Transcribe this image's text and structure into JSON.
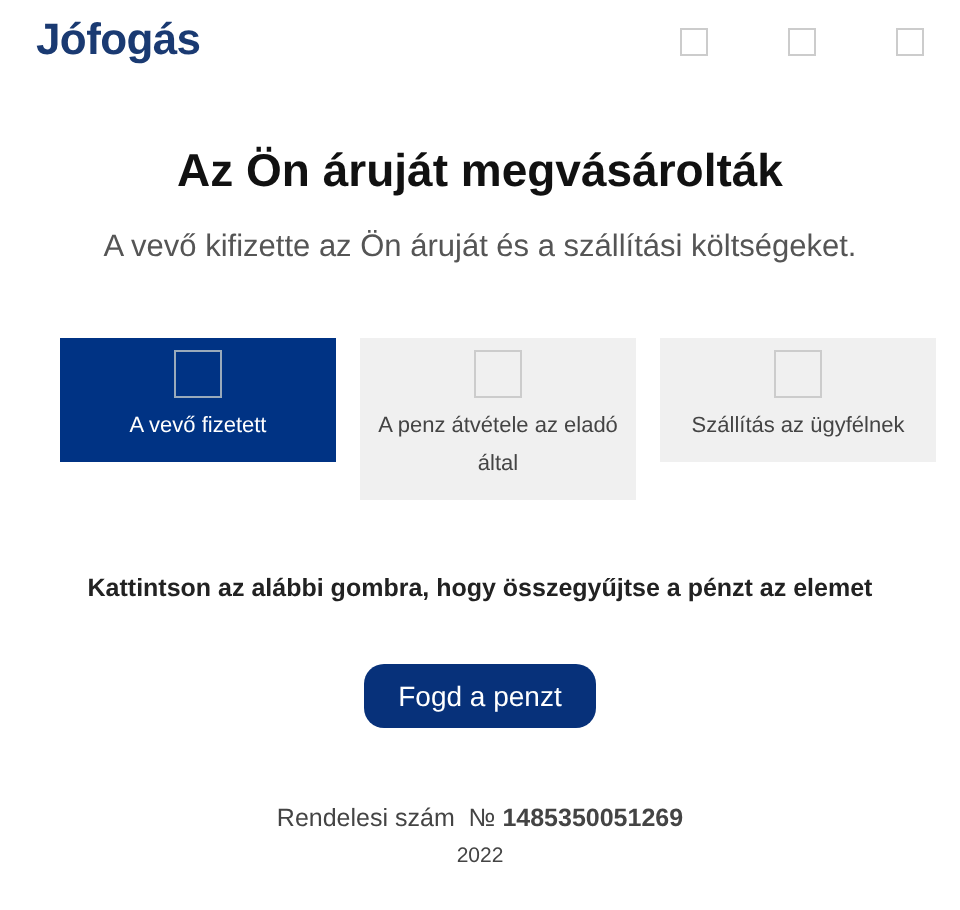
{
  "header": {
    "logo": "Jófogás"
  },
  "title": "Az Ön áruját megvásárolták",
  "subtitle": "A vevő kifizette az Ön áruját és a szállítási költségeket.",
  "steps": [
    {
      "label": "A vevő fizetett",
      "selected": true
    },
    {
      "label": "A penz átvétele az eladó által",
      "selected": false
    },
    {
      "label": "Szállítás az ügyfélnek",
      "selected": false
    }
  ],
  "instruction": "Kattintson az alábbi gombra, hogy összegyűjtse a pénzt az elemet",
  "button": "Fogd a penzt",
  "order": "Rendelesi szám  № **1485350051269**",
  "year": "2022"
}
